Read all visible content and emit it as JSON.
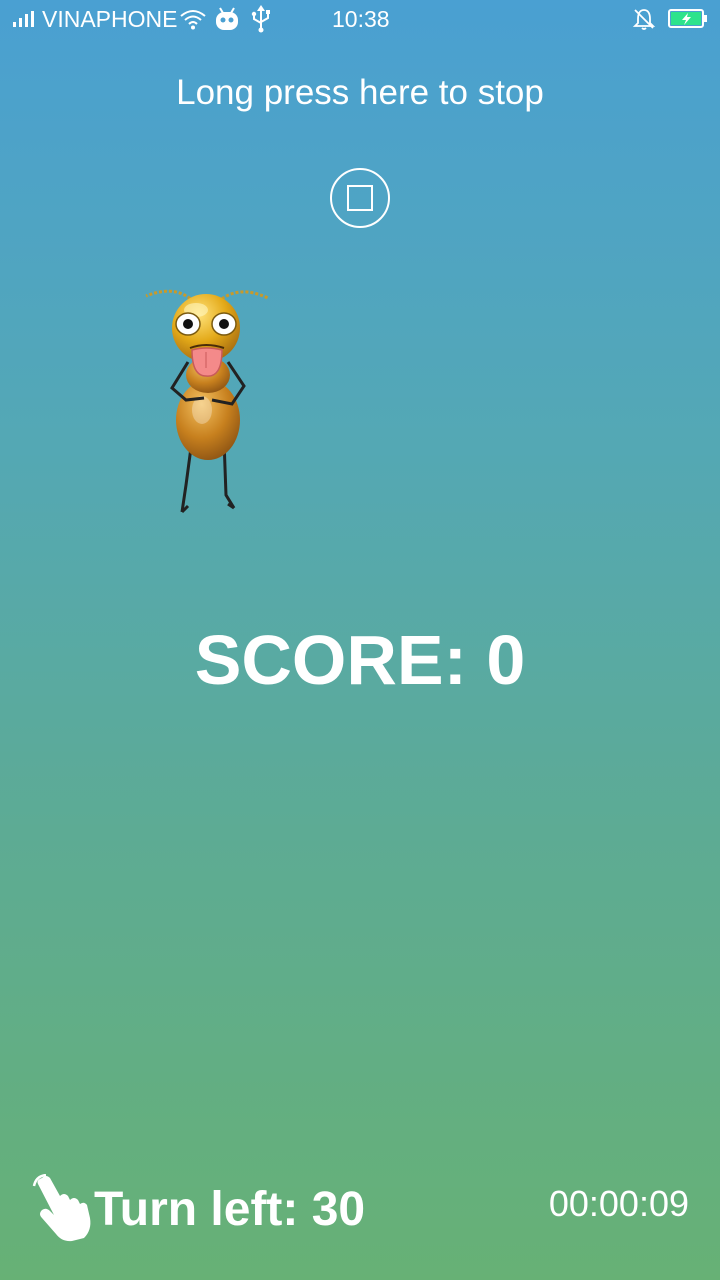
{
  "status_bar": {
    "carrier": "VINAPHONE",
    "time": "10:38",
    "icons": [
      "signal-icon",
      "wifi-icon",
      "android-robot-icon",
      "usb-icon",
      "muted-bell-icon",
      "battery-charging-icon"
    ]
  },
  "game": {
    "hint": "Long press here to stop",
    "score_label": "SCORE: 0",
    "turns_label": "Turn left: 30",
    "timer": "00:00:09",
    "character": "ant-character"
  },
  "colors": {
    "background_top": "#4aa0d2",
    "background_bottom": "#67b175",
    "text": "#ffffff",
    "battery_fill": "#2de38c"
  }
}
